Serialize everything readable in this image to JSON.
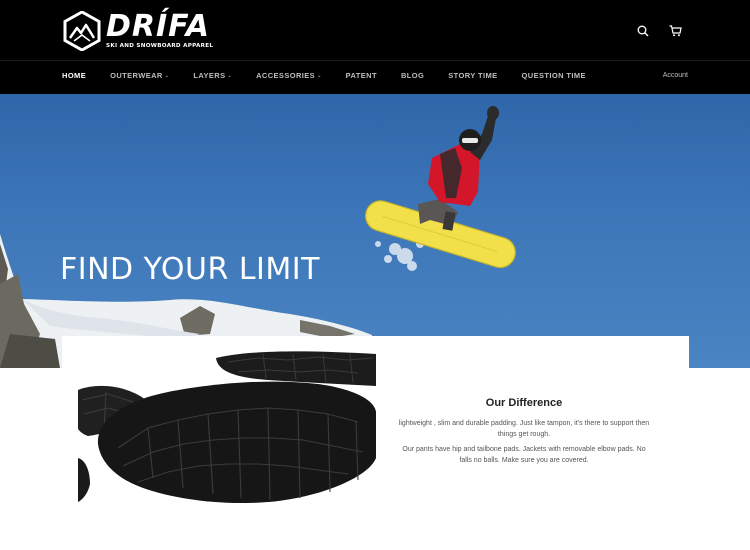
{
  "header": {
    "logo_word": "DRÍFA",
    "logo_sub": "SKI AND SNOWBOARD APPAREL",
    "icons": [
      "search-icon",
      "cart-icon"
    ]
  },
  "nav": {
    "items": [
      {
        "label": "HOME",
        "active": true,
        "dropdown": false
      },
      {
        "label": "OUTERWEAR",
        "active": false,
        "dropdown": true
      },
      {
        "label": "LAYERS",
        "active": false,
        "dropdown": true
      },
      {
        "label": "ACCESSORIES",
        "active": false,
        "dropdown": true
      },
      {
        "label": "PATENT",
        "active": false,
        "dropdown": false
      },
      {
        "label": "BLOG",
        "active": false,
        "dropdown": false
      },
      {
        "label": "STORY TIME",
        "active": false,
        "dropdown": false
      },
      {
        "label": "QUESTION TIME",
        "active": false,
        "dropdown": false
      }
    ],
    "caret": "⌄",
    "account": "Account"
  },
  "hero": {
    "title": "FIND YOUR LIMIT"
  },
  "difference": {
    "title": "Our Difference",
    "text1": "lightweight , slim and durable padding. Just like tampon, it's there to support then things get rough.",
    "text2": "Our pants have hip and tailbone pads. Jackets with removable elbow pads. No falls no balls. Make sure you are covered."
  },
  "colors": {
    "header_bg": "#000000",
    "sky": "#3d77b9",
    "jacket": "#d4162a",
    "board": "#f2e04a"
  }
}
